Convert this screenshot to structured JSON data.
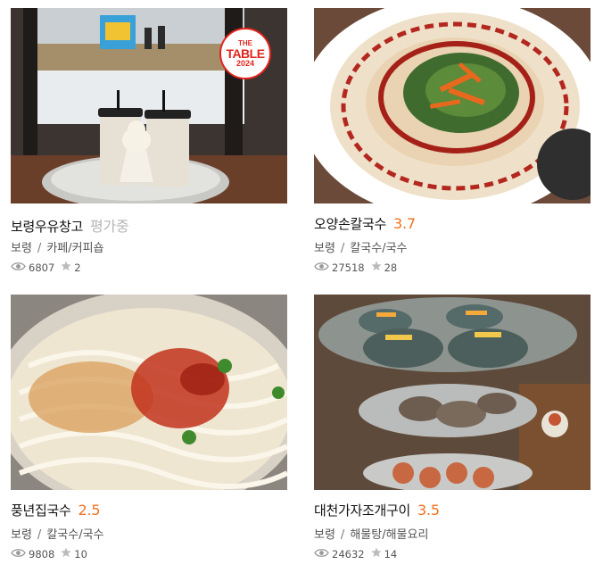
{
  "cards": [
    {
      "name": "보령우유창고",
      "score": "평가중",
      "region": "보령",
      "category": "카페/커피숍",
      "views": "6807",
      "stars": "2",
      "badge": {
        "line1": "THE",
        "line2": "TABLE",
        "line3": "2024"
      }
    },
    {
      "name": "오양손칼국수",
      "score": "3.7",
      "region": "보령",
      "category": "칼국수/국수",
      "views": "27518",
      "stars": "28"
    },
    {
      "name": "풍년집국수",
      "score": "2.5",
      "region": "보령",
      "category": "칼국수/국수",
      "views": "9808",
      "stars": "10"
    },
    {
      "name": "대천가자조개구이",
      "score": "3.5",
      "region": "보령",
      "category": "해물탕/해물요리",
      "views": "24632",
      "stars": "14"
    }
  ],
  "separator": "/",
  "colors": {
    "score": "#f2701f",
    "pending": "#b5b5b5",
    "badge": "#e2241d"
  }
}
